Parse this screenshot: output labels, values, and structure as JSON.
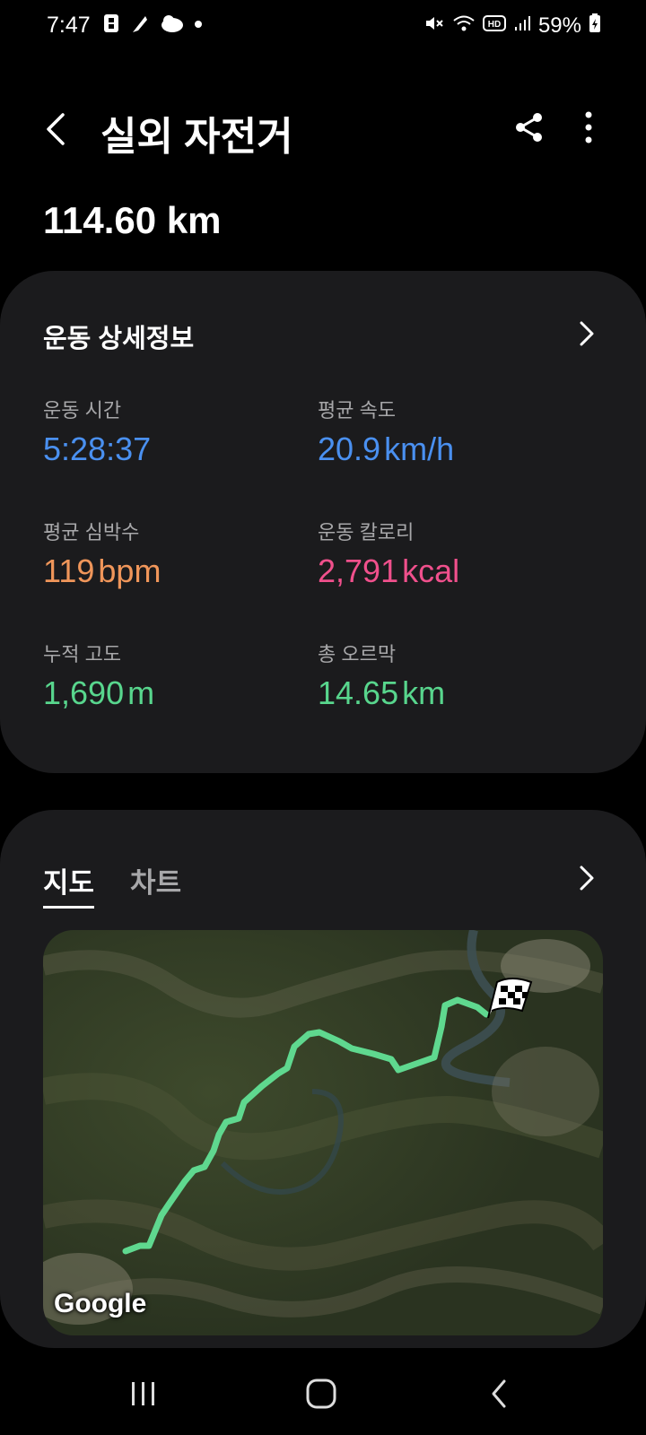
{
  "status_bar": {
    "time": "7:47",
    "battery": "59%",
    "left_icons": [
      "b-app-icon",
      "feather-app-icon",
      "cloud-app-icon",
      "dot-icon"
    ],
    "right_icons": [
      "mute-icon",
      "wifi-icon",
      "hd-icon",
      "signal-icon",
      "battery-charging-icon"
    ]
  },
  "app_bar": {
    "title": "실외 자전거"
  },
  "summary": {
    "distance": "114.60 km"
  },
  "details_card": {
    "title": "운동 상세정보",
    "stats": [
      {
        "label": "운동 시간",
        "value": "5:28:37",
        "unit": "",
        "color": "#4a90f0"
      },
      {
        "label": "평균 속도",
        "value": "20.9",
        "unit": "km/h",
        "color": "#4a90f0"
      },
      {
        "label": "평균 심박수",
        "value": "119",
        "unit": "bpm",
        "color": "#f0965a"
      },
      {
        "label": "운동 칼로리",
        "value": "2,791",
        "unit": "kcal",
        "color": "#f0508c"
      },
      {
        "label": "누적 고도",
        "value": "1,690",
        "unit": "m",
        "color": "#58d68d"
      },
      {
        "label": "총 오르막",
        "value": "14.65",
        "unit": "km",
        "color": "#58d68d"
      }
    ]
  },
  "map_card": {
    "tabs": [
      {
        "label": "지도",
        "active": true
      },
      {
        "label": "차트",
        "active": false
      }
    ],
    "map_provider": "Google",
    "route_color": "#5fd88f"
  }
}
